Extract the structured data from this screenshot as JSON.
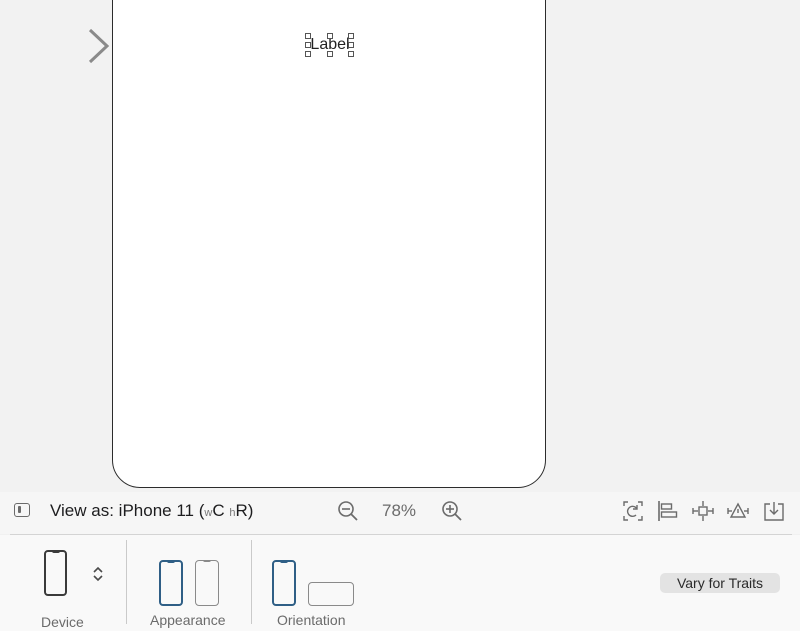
{
  "canvas": {
    "selected_label_text": "Label"
  },
  "toolbar": {
    "view_as_prefix": "View as: iPhone 11 (",
    "size_class_w_prefix": "w",
    "size_class_w": "C",
    "size_class_h_prefix": "h",
    "size_class_h": "R)",
    "zoom_level": "78%",
    "icons": [
      "sidebar-toggle-icon",
      "zoom-out-icon",
      "zoom-in-icon",
      "update-frames-icon",
      "align-icon",
      "add-constraints-icon",
      "resolve-issues-icon",
      "embed-in-icon"
    ]
  },
  "device_panel": {
    "device_label": "Device",
    "appearance_label": "Appearance",
    "orientation_label": "Orientation",
    "appearance_selected": "light",
    "orientation_selected": "portrait",
    "vary_button_label": "Vary for Traits",
    "accent_color": "#2f5f86"
  }
}
